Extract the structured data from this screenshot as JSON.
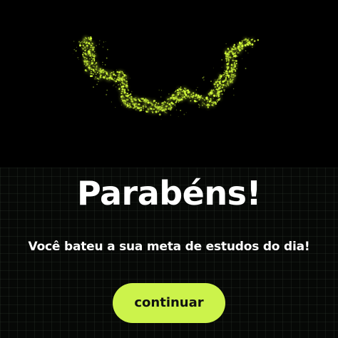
{
  "celebration": {
    "title": "Parabéns!",
    "message": "Você bateu a sua meta de estudos do dia!",
    "continue_label": "continuar"
  },
  "theme": {
    "background": "#000000",
    "accent": "#ccf34b",
    "glow": "#d6ff3b",
    "text": "#ffffff"
  },
  "icons": {
    "hero": "glowing-particle-ring-icon"
  }
}
